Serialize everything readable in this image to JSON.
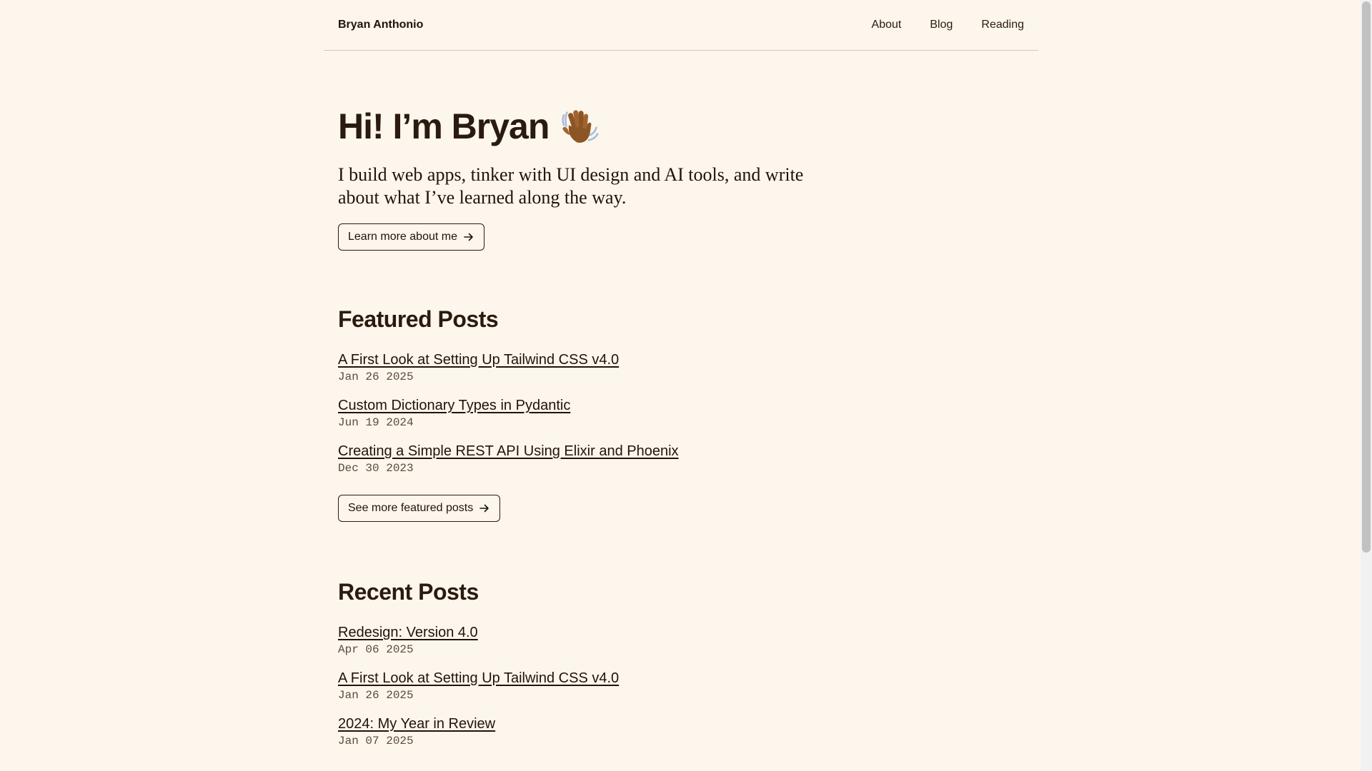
{
  "header": {
    "site_title": "Bryan Anthonio",
    "nav": [
      {
        "label": "About"
      },
      {
        "label": "Blog"
      },
      {
        "label": "Reading"
      }
    ]
  },
  "hero": {
    "title": "Hi! I’m Bryan",
    "emoji_icon": "waving-hand-icon",
    "intro": "I build web apps, tinker with UI design and AI tools, and write about what I’ve learned along the way.",
    "button_label": "Learn more about me"
  },
  "featured": {
    "title": "Featured Posts",
    "posts": [
      {
        "title": "A First Look at Setting Up Tailwind CSS v4.0",
        "date": "Jan 26 2025"
      },
      {
        "title": "Custom Dictionary Types in Pydantic",
        "date": "Jun 19 2024"
      },
      {
        "title": "Creating a Simple REST API Using Elixir and Phoenix",
        "date": "Dec 30 2023"
      }
    ],
    "button_label": "See more featured posts"
  },
  "recent": {
    "title": "Recent Posts",
    "posts": [
      {
        "title": "Redesign: Version 4.0",
        "date": "Apr 06 2025"
      },
      {
        "title": "A First Look at Setting Up Tailwind CSS v4.0",
        "date": "Jan 26 2025"
      },
      {
        "title": "2024: My Year in Review",
        "date": "Jan 07 2025"
      }
    ]
  },
  "colors": {
    "background": "#fdf6ec",
    "text": "#2b1a0f",
    "muted": "#5a4a3f"
  }
}
